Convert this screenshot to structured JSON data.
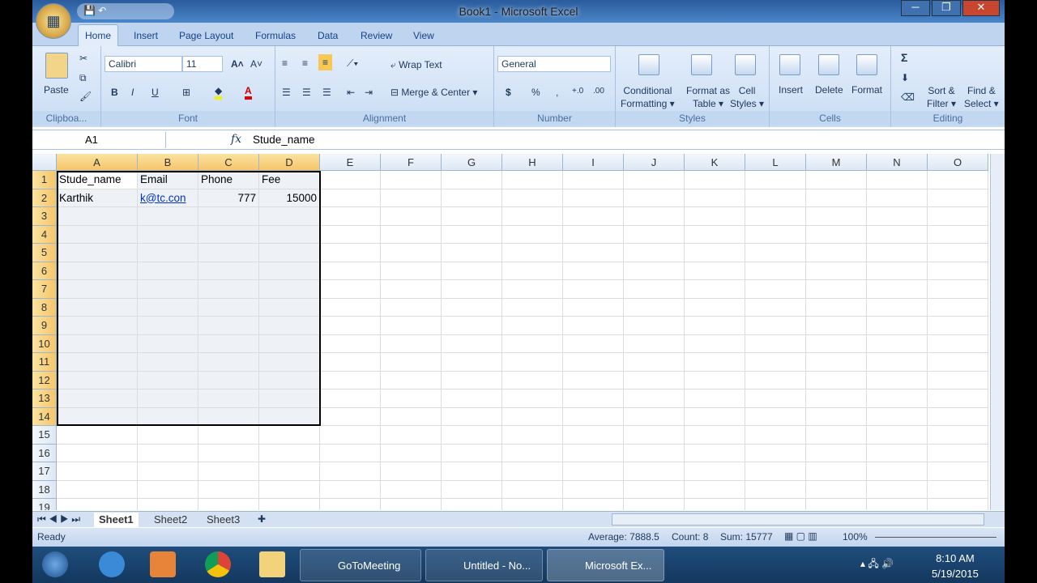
{
  "window": {
    "title": "Book1 - Microsoft Excel",
    "minimize": "─",
    "maximize": "❐",
    "close": "✕"
  },
  "qat": {
    "save": "💾",
    "undo": "↶"
  },
  "tabs": [
    "Home",
    "Insert",
    "Page Layout",
    "Formulas",
    "Data",
    "Review",
    "View"
  ],
  "ribbon": {
    "clipboard": {
      "label": "Clipboa...",
      "paste": "Paste"
    },
    "font": {
      "label": "Font",
      "name": "Calibri",
      "size": "11",
      "bold": "B",
      "italic": "I",
      "underline": "U",
      "grow": "A˄",
      "shrink": "A˅",
      "fill": "◆",
      "color": "A"
    },
    "alignment": {
      "label": "Alignment",
      "wrap": "Wrap Text",
      "merge": "Merge & Center"
    },
    "number": {
      "label": "Number",
      "format": "General",
      "currency": "$",
      "percent": "%",
      "comma": ",",
      "inc": "+.0",
      "dec": ".00"
    },
    "styles": {
      "label": "Styles",
      "conditional": [
        "Conditional",
        "Formatting ▾"
      ],
      "table": [
        "Format as",
        "Table ▾"
      ],
      "cell": [
        "Cell",
        "Styles ▾"
      ]
    },
    "cells": {
      "label": "Cells",
      "insert": "Insert",
      "delete": "Delete",
      "format": "Format"
    },
    "editing": {
      "label": "Editing",
      "sum": "Σ",
      "sort": [
        "Sort &",
        "Filter ▾"
      ],
      "find": [
        "Find &",
        "Select ▾"
      ]
    }
  },
  "formula_bar": {
    "name_box": "A1",
    "fx": "fx",
    "value": "Stude_name"
  },
  "columns": [
    "A",
    "B",
    "C",
    "D",
    "E",
    "F",
    "G",
    "H",
    "I",
    "J",
    "K",
    "L",
    "M",
    "N",
    "O"
  ],
  "rows": [
    "1",
    "2",
    "3",
    "4",
    "5",
    "6",
    "7",
    "8",
    "9",
    "10",
    "11",
    "12",
    "13",
    "14",
    "15",
    "16",
    "17",
    "18",
    "19"
  ],
  "cells": {
    "A1": "Stude_name",
    "B1": "Email",
    "C1": "Phone",
    "D1": "Fee",
    "A2": "Karthik",
    "B2": "k@tc.con",
    "C2": "777",
    "D2": "15000"
  },
  "sheets": [
    "Sheet1",
    "Sheet2",
    "Sheet3"
  ],
  "status": {
    "ready": "Ready",
    "average": "Average: 7888.5",
    "count": "Count: 8",
    "sum": "Sum: 15777",
    "zoom": "100%"
  },
  "taskbar": {
    "items": [
      "GoToMeeting",
      "Untitled - No...",
      "Microsoft Ex..."
    ],
    "time": "8:10 AM",
    "date": "5/19/2015"
  }
}
